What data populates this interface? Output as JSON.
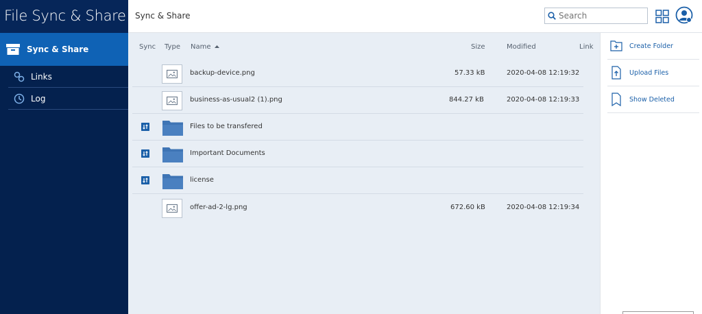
{
  "app": {
    "title": "File Sync & Share"
  },
  "sidebar": {
    "active": {
      "label": "Sync & Share",
      "icon": "archive-box-icon"
    },
    "items": [
      {
        "label": "Links",
        "icon": "link-icon"
      },
      {
        "label": "Log",
        "icon": "clock-icon"
      }
    ]
  },
  "header": {
    "breadcrumb": "Sync & Share",
    "search_placeholder": "Search"
  },
  "table": {
    "columns": {
      "sync": "Sync",
      "type": "Type",
      "name": "Name",
      "size": "Size",
      "modified": "Modified",
      "link": "Link"
    },
    "sort": {
      "column": "Name",
      "direction": "ascending"
    },
    "rows": [
      {
        "type": "image",
        "name": "backup-device.png",
        "size": "57.33 kB",
        "modified": "2020-04-08 12:19:32",
        "synced": false
      },
      {
        "type": "image",
        "name": "business-as-usual2 (1).png",
        "size": "844.27 kB",
        "modified": "2020-04-08 12:19:33",
        "synced": false
      },
      {
        "type": "folder",
        "name": "Files to be transfered",
        "size": "",
        "modified": "",
        "synced": true
      },
      {
        "type": "folder",
        "name": "Important Documents",
        "size": "",
        "modified": "",
        "synced": true
      },
      {
        "type": "folder",
        "name": "license",
        "size": "",
        "modified": "",
        "synced": true
      },
      {
        "type": "image",
        "name": "offer-ad-2-lg.png",
        "size": "672.60 kB",
        "modified": "2020-04-08 12:19:34",
        "synced": false
      }
    ]
  },
  "actions": [
    {
      "label": "Create Folder",
      "icon": "folder-plus-icon"
    },
    {
      "label": "Upload Files",
      "icon": "upload-file-icon"
    },
    {
      "label": "Show Deleted",
      "icon": "bookmark-file-icon"
    }
  ],
  "colors": {
    "sidebar": "#04214e",
    "active": "#0f62b5",
    "main_bg": "#e8eef5",
    "accent": "#1a5fa8"
  }
}
